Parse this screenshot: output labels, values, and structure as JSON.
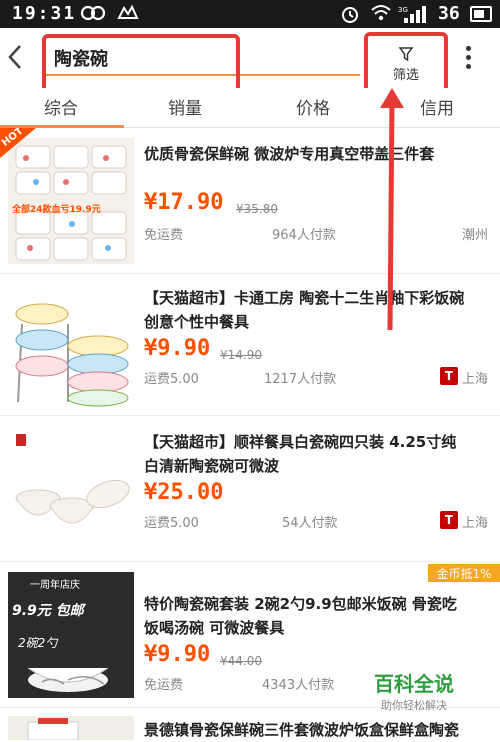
{
  "status_bar": {
    "time": "19:31",
    "battery": "36"
  },
  "search": {
    "query": "陶瓷碗",
    "filter_label": "筛选"
  },
  "sort_tabs": [
    {
      "label": "综合",
      "active": true
    },
    {
      "label": "销量",
      "active": false
    },
    {
      "label": "价格",
      "active": false
    },
    {
      "label": "信用",
      "active": false
    }
  ],
  "products": [
    {
      "title_line1": "优质骨瓷保鲜碗 微波炉专用真空带盖三件套",
      "title_line2": "",
      "price": "¥17.90",
      "old_price": "¥35.80",
      "shipping": "免运费",
      "sold": "964人付款",
      "location": "潮州",
      "badge": "HOT",
      "thumb_text": "全部24款血亏19.9元",
      "tmall": false
    },
    {
      "title_line1": "【天猫超市】卡通工房 陶瓷十二生肖釉下彩饭碗",
      "title_line2": "创意个性中餐具",
      "price": "¥9.90",
      "old_price": "¥14.90",
      "shipping": "运费5.00",
      "sold": "1217人付款",
      "location": "上海",
      "tmall": true
    },
    {
      "title_line1": "【天猫超市】顺祥餐具白瓷碗四只装 4.25寸纯",
      "title_line2": "白清新陶瓷碗可微波",
      "price": "¥25.00",
      "old_price": "",
      "shipping": "运费5.00",
      "sold": "54人付款",
      "location": "上海",
      "tmall": true
    },
    {
      "title_line1": "特价陶瓷碗套装 2碗2勺9.9包邮米饭碗 骨瓷吃",
      "title_line2": "饭喝汤碗 可微波餐具",
      "price": "¥9.90",
      "old_price": "¥44.00",
      "shipping": "免运费",
      "sold": "4343人付款",
      "location": "",
      "gold_badge": "金币抵1%",
      "thumb_lines": [
        "一周年店庆",
        "9.9元 包邮",
        "2碗2勺"
      ],
      "tmall": false
    },
    {
      "title_line1": "景德镇骨瓷保鲜碗三件套微波炉饭盒保鲜盒陶瓷",
      "title_line2": "",
      "tmall": false
    }
  ],
  "watermark": {
    "main": "百科全说",
    "sub": "助你轻松解决"
  },
  "colors": {
    "accent": "#ff5000",
    "highlight": "#e53935",
    "tab_underline": "#f08d49",
    "tmall": "#c40000"
  }
}
